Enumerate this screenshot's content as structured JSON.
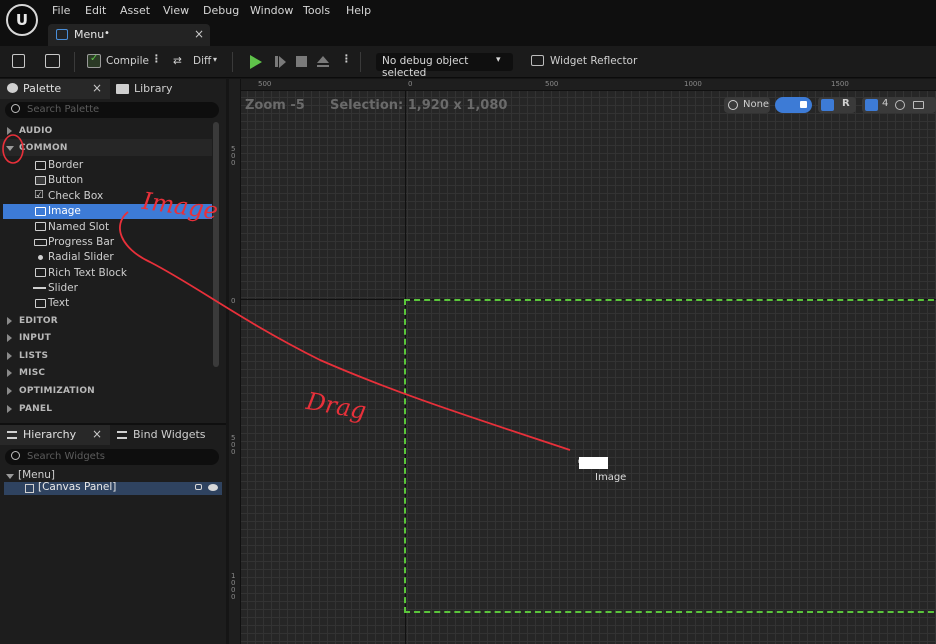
{
  "menubar": {
    "items": [
      "File",
      "Edit",
      "Asset",
      "View",
      "Debug",
      "Window",
      "Tools",
      "Help"
    ]
  },
  "logo": "U",
  "doc_tab": {
    "label": "Menu",
    "modified": "•",
    "close": "×"
  },
  "toolbar": {
    "compile": "Compile",
    "diff": "Diff",
    "debug_select": "No debug object selected",
    "widget_reflector": "Widget Reflector"
  },
  "palette": {
    "tab_palette": "Palette",
    "tab_close": "×",
    "tab_library": "Library",
    "search_placeholder": "Search Palette",
    "categories_before": [
      "AUDIO"
    ],
    "expanded_category": "COMMON",
    "common_items": [
      "Border",
      "Button",
      "Check Box",
      "Image",
      "Named Slot",
      "Progress Bar",
      "Radial Slider",
      "Rich Text Block",
      "Slider",
      "Text"
    ],
    "categories_after": [
      "EDITOR",
      "INPUT",
      "LISTS",
      "MISC",
      "OPTIMIZATION",
      "PANEL"
    ]
  },
  "hierarchy": {
    "tab_hierarchy": "Hierarchy",
    "tab_close": "×",
    "tab_bind": "Bind Widgets",
    "search_placeholder": "Search Widgets",
    "root": "[Menu]",
    "child": "[Canvas Panel]"
  },
  "designer": {
    "zoom": "Zoom -5",
    "selection": "Selection: 1,920 x 1,080",
    "ruler_top": [
      "500",
      "0",
      "500",
      "1000",
      "1500"
    ],
    "ruler_left": [
      "5\n0\n0",
      "0",
      "5\n0\n0",
      "1\n0\n0\n0"
    ],
    "localize": "None",
    "r_label": "R",
    "grid_count": "4",
    "drag_label": "Image"
  },
  "annotations": {
    "image_note": "Image",
    "drag_note": "Drag"
  },
  "colors": {
    "accent": "#3d7bd6",
    "selection_border": "#5ac63b",
    "annotation": "#e8303a",
    "play": "#5fc24a"
  }
}
